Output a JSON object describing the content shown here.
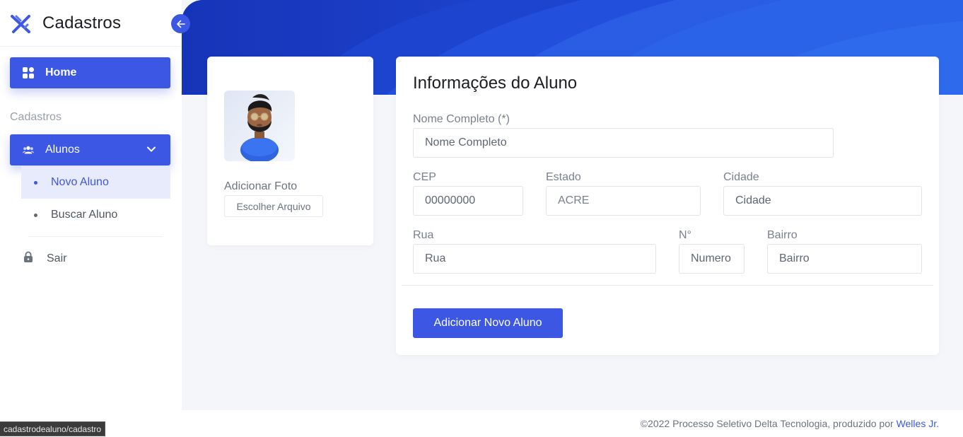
{
  "brand": {
    "name": "Cadastros",
    "icon": "logo-icon"
  },
  "sidebar": {
    "home_label": "Home",
    "section_label": "Cadastros",
    "alunos_label": "Alunos",
    "subitems": [
      {
        "label": "Novo Aluno",
        "active": true
      },
      {
        "label": "Buscar Aluno",
        "active": false
      }
    ],
    "logout_label": "Sair"
  },
  "photo_card": {
    "label": "Adicionar Foto",
    "file_button": "Escolher Arquivo"
  },
  "form": {
    "title": "Informações do Aluno",
    "fields": {
      "nome": {
        "label": "Nome Completo (*)",
        "placeholder": "Nome Completo"
      },
      "cep": {
        "label": "CEP",
        "placeholder": "00000000"
      },
      "estado": {
        "label": "Estado",
        "value": "ACRE"
      },
      "cidade": {
        "label": "Cidade",
        "placeholder": "Cidade"
      },
      "rua": {
        "label": "Rua",
        "placeholder": "Rua"
      },
      "numero": {
        "label": "N°",
        "placeholder": "Numero"
      },
      "bairro": {
        "label": "Bairro",
        "placeholder": "Bairro"
      }
    },
    "submit_label": "Adicionar Novo Aluno"
  },
  "footer": {
    "text": "©2022 Processo Seletivo Delta Tecnologia, produzido por ",
    "link": "Welles Jr."
  },
  "statusbar": {
    "url": "cadastrodealuno/cadastro"
  },
  "colors": {
    "primary": "#3b57e3",
    "background": "#f4f6fa",
    "hero": "#1e3fc4"
  }
}
